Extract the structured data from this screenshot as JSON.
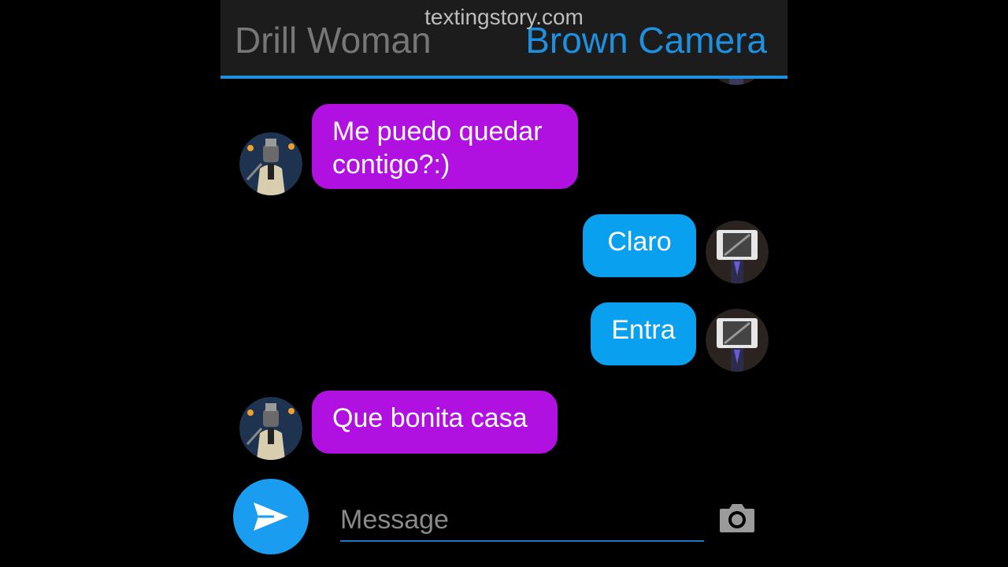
{
  "watermark": "textingstory.com",
  "header": {
    "contact_left": "Drill Woman",
    "contact_right": "Brown Camera"
  },
  "messages": [
    {
      "side": "left",
      "text": "Me puedo quedar contigo?:)",
      "line1": "Me puedo quedar",
      "line2": "contigo?:)"
    },
    {
      "side": "right",
      "text": "Claro"
    },
    {
      "side": "right",
      "text": "Entra"
    },
    {
      "side": "left",
      "text": "Que bonita casa"
    }
  ],
  "composer": {
    "placeholder": "Message",
    "send_icon": "send-icon",
    "camera_icon": "camera-icon"
  },
  "colors": {
    "left_bubble": "#b010e0",
    "right_bubble": "#0aa0f0",
    "accent": "#1e90e0",
    "header_bg": "#1c1c1c"
  }
}
